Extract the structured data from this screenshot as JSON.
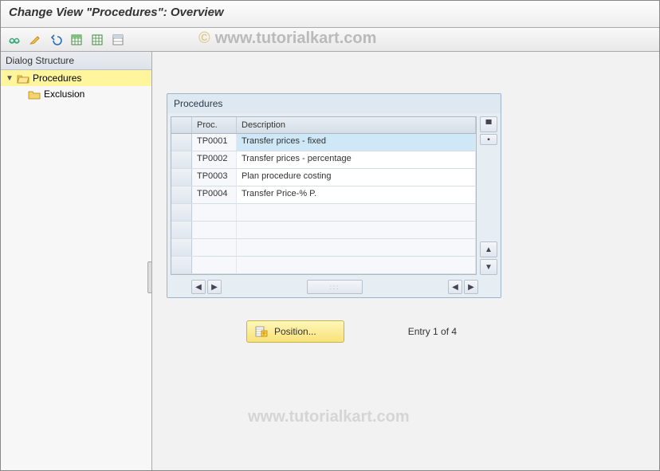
{
  "title": "Change View \"Procedures\": Overview",
  "watermark": "www.tutorialkart.com",
  "watermark_prefix": "©",
  "sidebar": {
    "header": "Dialog Structure",
    "root": {
      "label": "Procedures",
      "expanded": true,
      "selected": true
    },
    "child": {
      "label": "Exclusion"
    }
  },
  "panel": {
    "title": "Procedures",
    "columns": {
      "selector": "",
      "proc": "Proc.",
      "desc": "Description"
    },
    "rows": [
      {
        "proc": "TP0001",
        "desc": "Transfer prices - fixed",
        "selected": true
      },
      {
        "proc": "TP0002",
        "desc": "Transfer prices - percentage"
      },
      {
        "proc": "TP0003",
        "desc": "Plan procedure costing"
      },
      {
        "proc": "TP0004",
        "desc": "Transfer Price-% P."
      }
    ],
    "empty_rows": 4
  },
  "footer": {
    "position_label": "Position...",
    "entry_text": "Entry 1 of 4"
  },
  "toolbar_icons": [
    "other-view",
    "new-entries",
    "undo",
    "select-all",
    "deselect-all",
    "config"
  ]
}
